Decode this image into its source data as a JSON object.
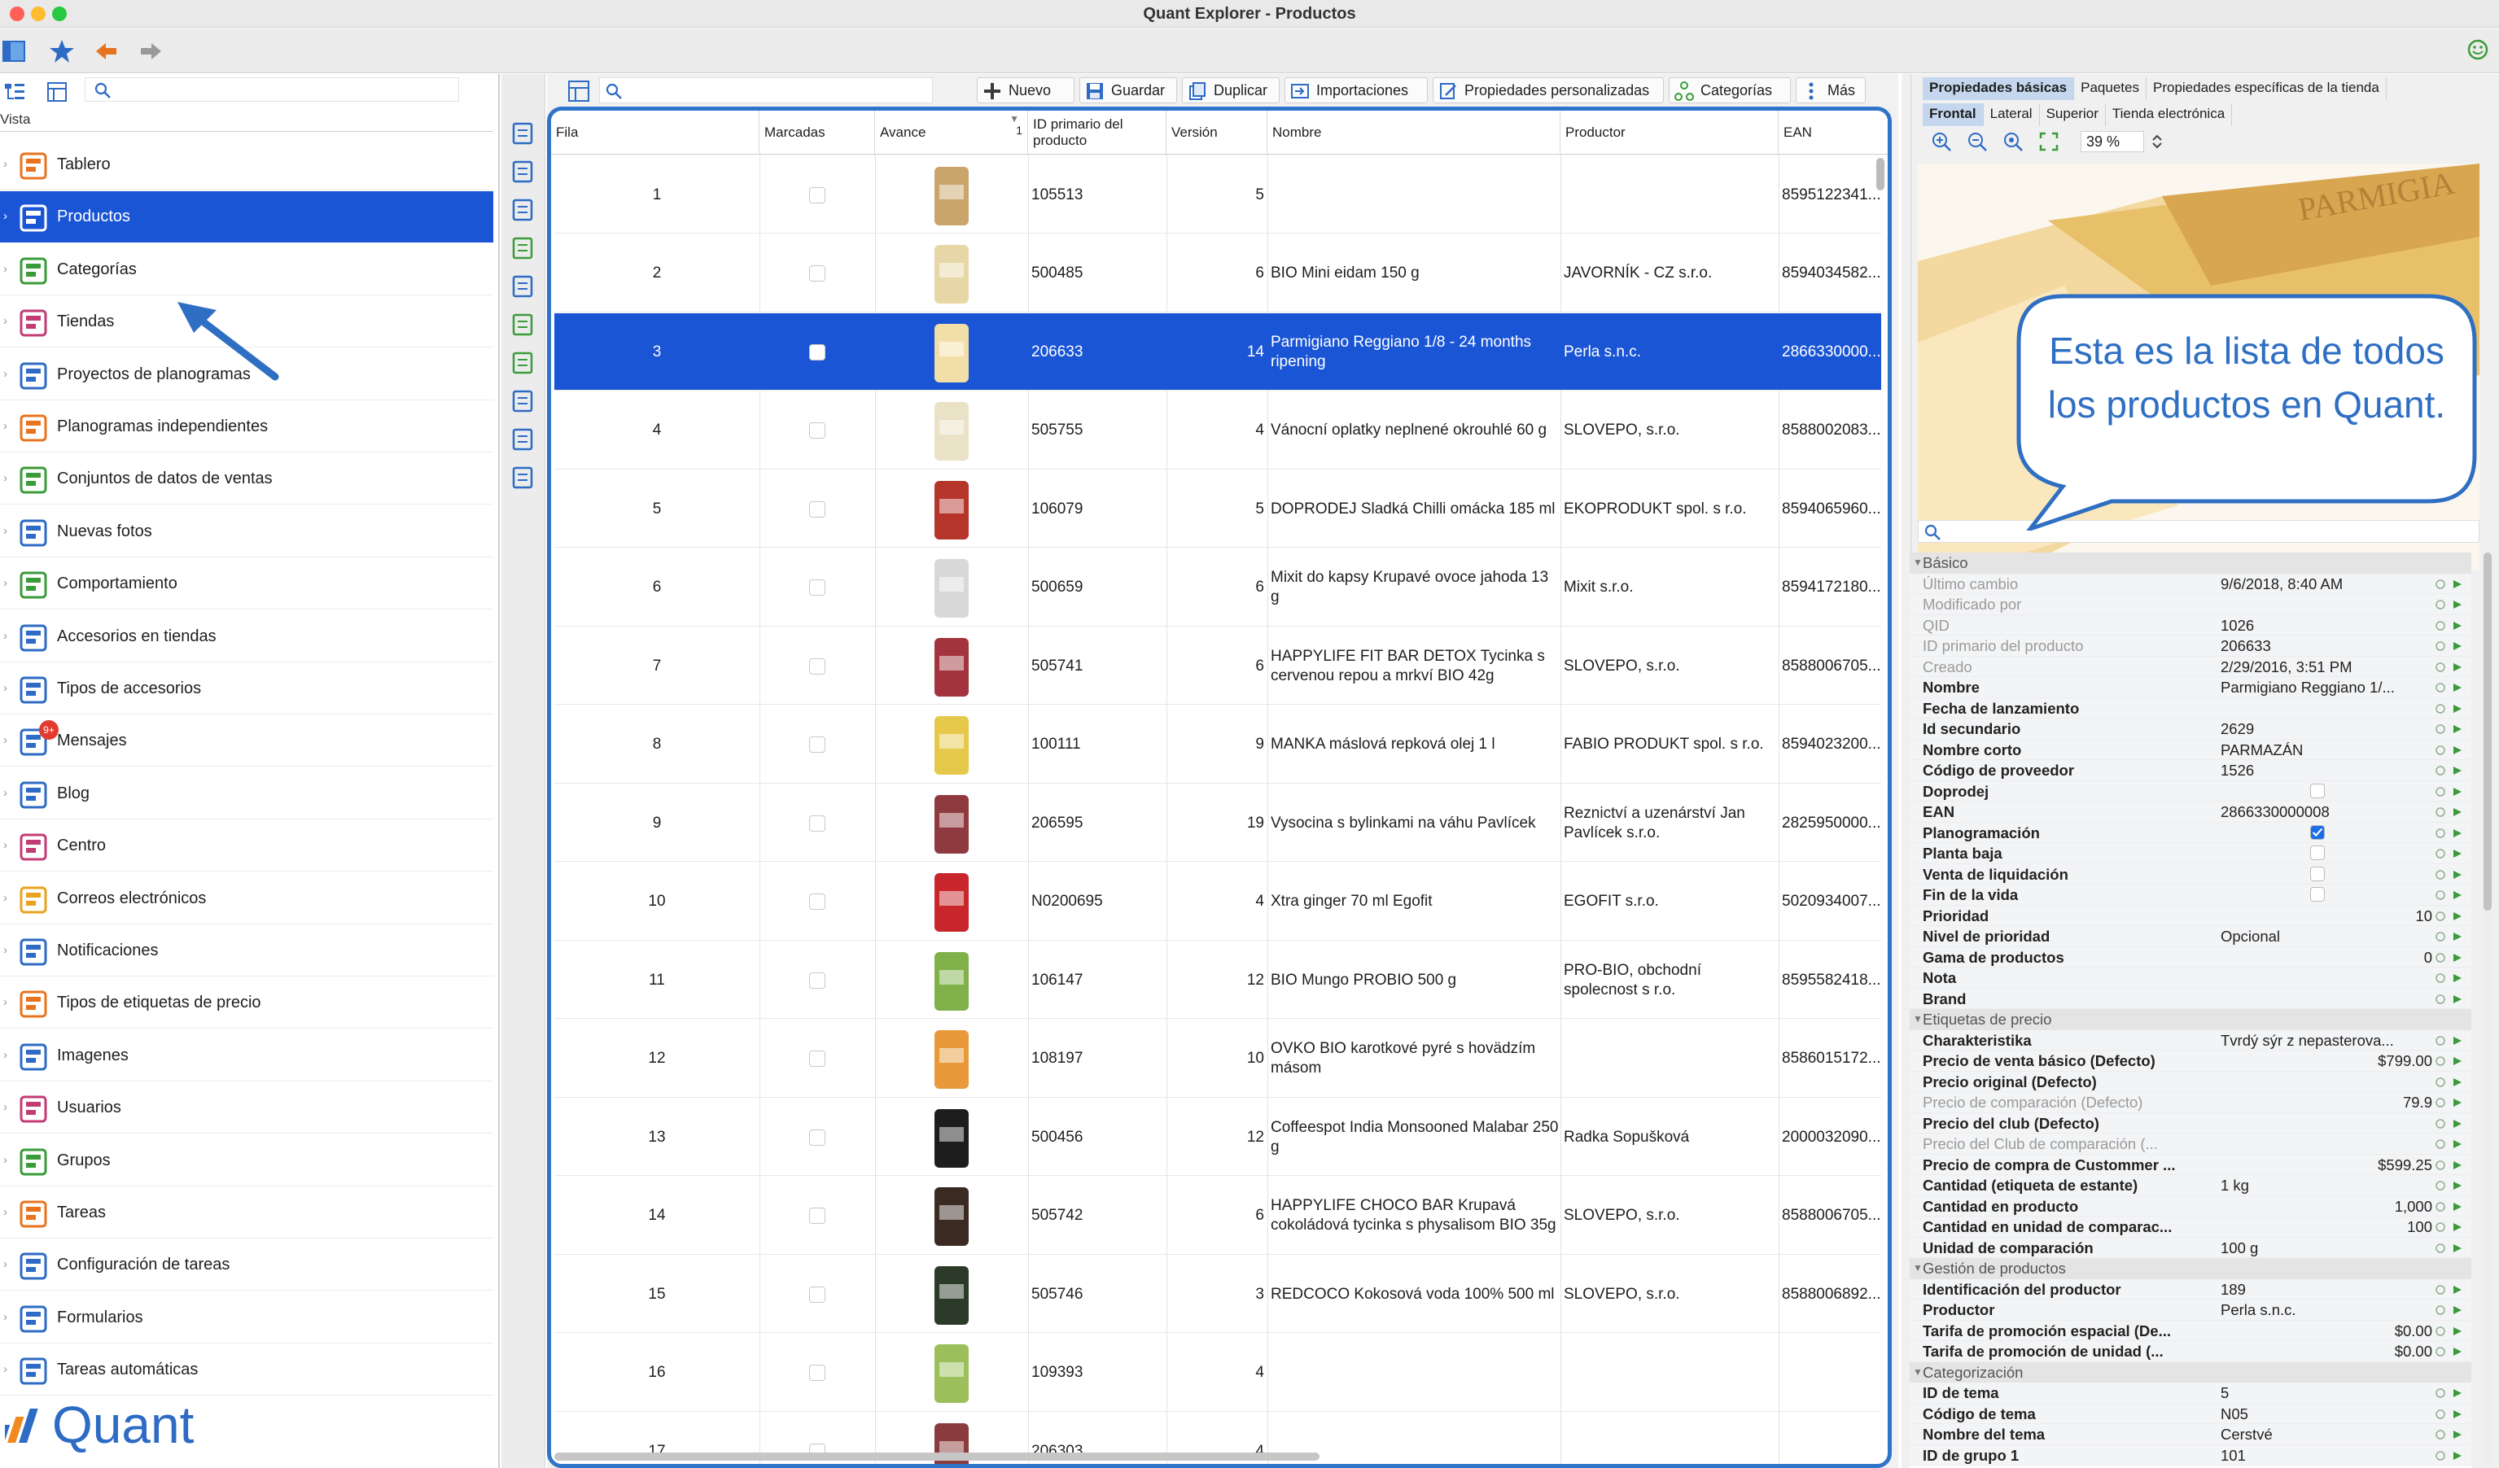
{
  "window": {
    "title": "Quant Explorer - Productos"
  },
  "left_panel": {
    "vista_label": "Vista",
    "nav_items": [
      {
        "label": "Tablero",
        "icon": "dashboard-icon"
      },
      {
        "label": "Productos",
        "icon": "products-icon",
        "active": true
      },
      {
        "label": "Categorías",
        "icon": "categories-icon"
      },
      {
        "label": "Tiendas",
        "icon": "stores-icon"
      },
      {
        "label": "Proyectos de planogramas",
        "icon": "planogram-projects-icon"
      },
      {
        "label": "Planogramas independientes",
        "icon": "planograms-icon"
      },
      {
        "label": "Conjuntos de datos de ventas",
        "icon": "sales-data-icon"
      },
      {
        "label": "Nuevas fotos",
        "icon": "camera-icon"
      },
      {
        "label": "Comportamiento",
        "icon": "behavior-icon"
      },
      {
        "label": "Accesorios en tiendas",
        "icon": "accessories-icon"
      },
      {
        "label": "Tipos de accesorios",
        "icon": "accessory-types-icon"
      },
      {
        "label": "Mensajes",
        "icon": "messages-icon",
        "badge": "9+"
      },
      {
        "label": "Blog",
        "icon": "blog-icon"
      },
      {
        "label": "Centro",
        "icon": "center-icon"
      },
      {
        "label": "Correos electrónicos",
        "icon": "email-icon"
      },
      {
        "label": "Notificaciones",
        "icon": "notifications-icon"
      },
      {
        "label": "Tipos de etiquetas de precio",
        "icon": "price-tag-icon"
      },
      {
        "label": "Imagenes",
        "icon": "images-icon"
      },
      {
        "label": "Usuarios",
        "icon": "users-icon"
      },
      {
        "label": "Grupos",
        "icon": "groups-icon"
      },
      {
        "label": "Tareas",
        "icon": "tasks-icon"
      },
      {
        "label": "Configuración de tareas",
        "icon": "task-config-icon"
      },
      {
        "label": "Formularios",
        "icon": "forms-icon"
      },
      {
        "label": "Tareas automáticas",
        "icon": "auto-tasks-icon"
      }
    ],
    "logo_text": "Quant"
  },
  "center_toolbar": {
    "new": "Nuevo",
    "save": "Guardar",
    "duplicate": "Duplicar",
    "imports": "Importaciones",
    "custom_props": "Propiedades personalizadas",
    "categories": "Categorías",
    "more": "Más"
  },
  "grid": {
    "columns": [
      "Fila",
      "Marcadas",
      "Avance",
      "ID primario del producto",
      "Versión",
      "Nombre",
      "Productor",
      "EAN"
    ],
    "sort_indicator": "1",
    "rows": [
      {
        "row": "1",
        "id": "105513",
        "version": "5",
        "name": "",
        "producer": "",
        "ean": "8595122341...",
        "thumb": "#c9a46b"
      },
      {
        "row": "2",
        "id": "500485",
        "version": "6",
        "name": "BIO Mini eidam 150 g",
        "producer": "JAVORNÍK - CZ s.r.o.",
        "ean": "8594034582...",
        "thumb": "#e8d7a6"
      },
      {
        "row": "3",
        "id": "206633",
        "version": "14",
        "name": "Parmigiano Reggiano 1/8 - 24 months ripening",
        "producer": "Perla s.n.c.",
        "ean": "2866330000...",
        "thumb": "#f2dfa8",
        "selected": true
      },
      {
        "row": "4",
        "id": "505755",
        "version": "4",
        "name": "Vánocní oplatky neplnené okrouhlé 60 g",
        "producer": "SLOVEPO, s.r.o.",
        "ean": "8588002083...",
        "thumb": "#e9e2c6"
      },
      {
        "row": "5",
        "id": "106079",
        "version": "5",
        "name": "DOPRODEJ Sladká Chilli omácka 185 ml",
        "producer": "EKOPRODUKT spol. s r.o.",
        "ean": "8594065960...",
        "thumb": "#b5352a"
      },
      {
        "row": "6",
        "id": "500659",
        "version": "6",
        "name": "Mixit do kapsy Krupavé ovoce jahoda 13 g",
        "producer": "Mixit s.r.o.",
        "ean": "8594172180...",
        "thumb": "#d8d8d8"
      },
      {
        "row": "7",
        "id": "505741",
        "version": "6",
        "name": "HAPPYLIFE FIT BAR DETOX Tycinka s cervenou repou a mrkví BIO 42g",
        "producer": "SLOVEPO, s.r.o.",
        "ean": "8588006705...",
        "thumb": "#a3343d"
      },
      {
        "row": "8",
        "id": "100111",
        "version": "9",
        "name": "MANKA máslová repková olej 1 l",
        "producer": "FABIO PRODUKT spol. s r.o.",
        "ean": "8594023200...",
        "thumb": "#e6c94a"
      },
      {
        "row": "9",
        "id": "206595",
        "version": "19",
        "name": "Vysocina s bylinkami na váhu Pavlícek",
        "producer": "Reznictví a uzenárství Jan Pavlícek s.r.o.",
        "ean": "2825950000...",
        "thumb": "#8e3a3e"
      },
      {
        "row": "10",
        "id": "N0200695",
        "version": "4",
        "name": "Xtra ginger 70 ml Egofit",
        "producer": "EGOFIT s.r.o.",
        "ean": "5020934007...",
        "thumb": "#c8262a"
      },
      {
        "row": "11",
        "id": "106147",
        "version": "12",
        "name": "BIO Mungo PROBIO 500 g",
        "producer": "PRO-BIO, obchodní spolecnost s r.o.",
        "ean": "8595582418...",
        "thumb": "#7fb04a"
      },
      {
        "row": "12",
        "id": "108197",
        "version": "10",
        "name": "OVKO BIO karotkové pyré s hovädzím másom",
        "producer": "",
        "ean": "8586015172...",
        "thumb": "#e89a3a"
      },
      {
        "row": "13",
        "id": "500456",
        "version": "12",
        "name": "Coffeespot India Monsooned Malabar 250 g",
        "producer": "Radka Sopušková",
        "ean": "2000032090...",
        "thumb": "#1d1d1d"
      },
      {
        "row": "14",
        "id": "505742",
        "version": "6",
        "name": "HAPPYLIFE CHOCO BAR Krupavá cokoládová tycinka s physalisom BIO 35g",
        "producer": "SLOVEPO, s.r.o.",
        "ean": "8588006705...",
        "thumb": "#3a2a22"
      },
      {
        "row": "15",
        "id": "505746",
        "version": "3",
        "name": "REDCOCO Kokosová voda 100% 500 ml",
        "producer": "SLOVEPO, s.r.o.",
        "ean": "8588006892...",
        "thumb": "#2c3a2a"
      },
      {
        "row": "16",
        "id": "109393",
        "version": "4",
        "name": "",
        "producer": "",
        "ean": "",
        "thumb": "#9bbf5a"
      },
      {
        "row": "17",
        "id": "206303",
        "version": "4",
        "name": "",
        "producer": "",
        "ean": "",
        "thumb": "#8a3c3c"
      }
    ]
  },
  "right_panel": {
    "tabs_top": [
      "Propiedades básicas",
      "Paquetes",
      "Propiedades específicas de la tienda"
    ],
    "tabs_view": [
      "Frontal",
      "Lateral",
      "Superior",
      "Tienda electrónica"
    ],
    "zoom": "39 %",
    "properties": [
      {
        "type": "section",
        "name": "Básico"
      },
      {
        "name": "Último cambio",
        "value": "9/6/2018, 8:40 AM",
        "muted": true
      },
      {
        "name": "Modificado por",
        "value": "",
        "muted": true
      },
      {
        "name": "QID",
        "value": "1026",
        "muted": true
      },
      {
        "name": "ID primario del producto",
        "value": "206633",
        "muted": true
      },
      {
        "name": "Creado",
        "value": "2/29/2016, 3:51 PM",
        "muted": true
      },
      {
        "name": "Nombre",
        "value": "Parmigiano Reggiano 1/..."
      },
      {
        "name": "Fecha de lanzamiento",
        "value": ""
      },
      {
        "name": "Id secundario",
        "value": "2629"
      },
      {
        "name": "Nombre corto",
        "value": "PARMAZÁN"
      },
      {
        "name": "Código de proveedor",
        "value": "1526"
      },
      {
        "name": "Doprodej",
        "value": "",
        "checkbox": "off"
      },
      {
        "name": "EAN",
        "value": "2866330000008"
      },
      {
        "name": "Planogramación",
        "value": "",
        "checkbox": "on"
      },
      {
        "name": "Planta baja",
        "value": "",
        "checkbox": "off"
      },
      {
        "name": "Venta de liquidación",
        "value": "",
        "checkbox": "off"
      },
      {
        "name": "Fin de la vida",
        "value": "",
        "checkbox": "off"
      },
      {
        "name": "Prioridad",
        "value": "10",
        "right": true
      },
      {
        "name": "Nivel de prioridad",
        "value": "Opcional"
      },
      {
        "name": "Gama de productos",
        "value": "0",
        "right": true
      },
      {
        "name": "Nota",
        "value": ""
      },
      {
        "name": "Brand",
        "value": ""
      },
      {
        "type": "section",
        "name": "Etiquetas de precio"
      },
      {
        "name": "Charakteristika",
        "value": "Tvrdý sýr z nepasterova..."
      },
      {
        "name": "Precio de venta básico (Defecto)",
        "value": "$799.00",
        "right": true
      },
      {
        "name": "Precio original (Defecto)",
        "value": ""
      },
      {
        "name": "Precio de comparación (Defecto)",
        "value": "79.9",
        "right": true,
        "muted": true
      },
      {
        "name": "Precio del club (Defecto)",
        "value": ""
      },
      {
        "name": "Precio del Club de comparación (...",
        "value": "",
        "muted": true
      },
      {
        "name": "Precio de compra de Custommer ...",
        "value": "$599.25",
        "right": true
      },
      {
        "name": "Cantidad (etiqueta de estante)",
        "value": "1 kg"
      },
      {
        "name": "Cantidad en producto",
        "value": "1,000",
        "right": true
      },
      {
        "name": "Cantidad en unidad de comparac...",
        "value": "100",
        "right": true
      },
      {
        "name": "Unidad de comparación",
        "value": "100 g"
      },
      {
        "type": "section",
        "name": "Gestión de productos"
      },
      {
        "name": "Identificación del productor",
        "value": "189"
      },
      {
        "name": "Productor",
        "value": "Perla s.n.c."
      },
      {
        "name": "Tarifa de promoción espacial (De...",
        "value": "$0.00",
        "right": true
      },
      {
        "name": "Tarifa de promoción de unidad (...",
        "value": "$0.00",
        "right": true
      },
      {
        "type": "section",
        "name": "Categorización"
      },
      {
        "name": "ID de tema",
        "value": "5"
      },
      {
        "name": "Código de tema",
        "value": "N05"
      },
      {
        "name": "Nombre del tema",
        "value": "Cerstvé"
      },
      {
        "name": "ID de grupo 1",
        "value": "101"
      }
    ]
  },
  "callout": {
    "text": "Esta es la lista de todos los productos en Quant."
  },
  "colors": {
    "accent": "#1a55d5",
    "callout": "#2f6fc3",
    "grid_border": "#2f74c9"
  }
}
